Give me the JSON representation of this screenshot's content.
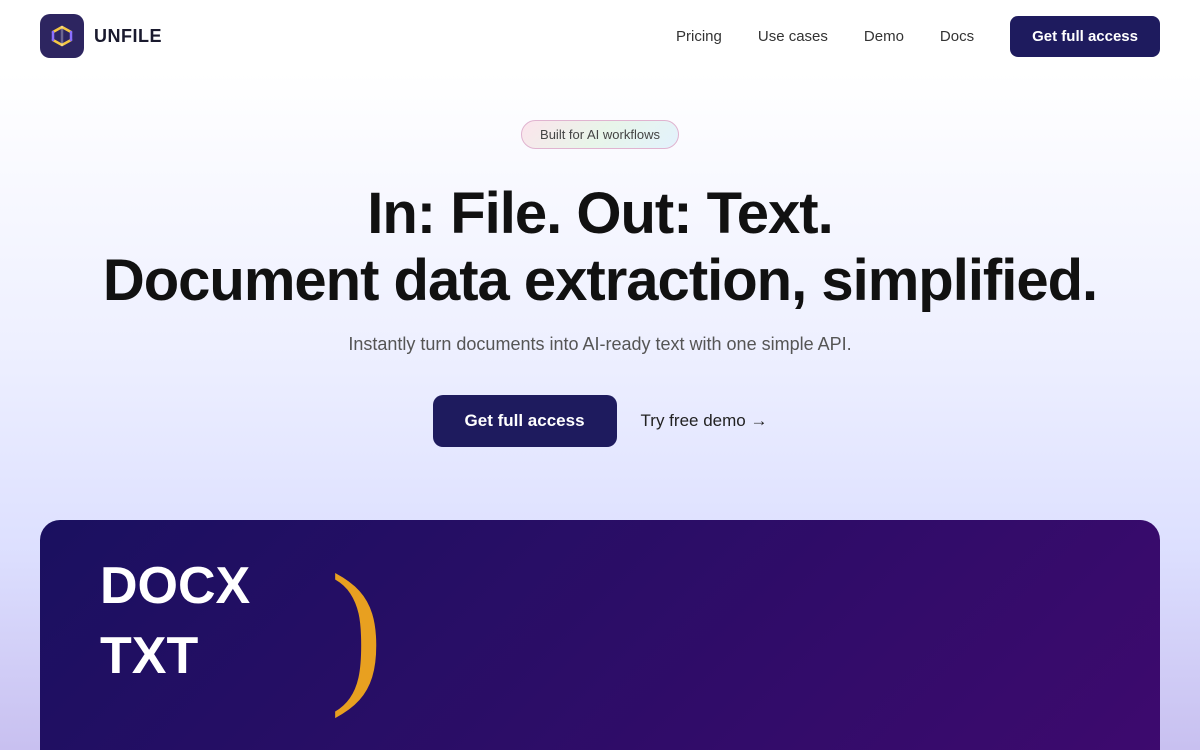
{
  "header": {
    "logo_text": "UNFILE",
    "nav": {
      "items": [
        {
          "label": "Pricing",
          "id": "pricing"
        },
        {
          "label": "Use cases",
          "id": "use-cases"
        },
        {
          "label": "Demo",
          "id": "demo"
        },
        {
          "label": "Docs",
          "id": "docs"
        }
      ],
      "cta_label": "Get full access"
    }
  },
  "hero": {
    "badge_text": "Built for AI workflows",
    "headline_line1": "In: File. Out: Text.",
    "headline_line2": "Document data extraction, simplified.",
    "subheadline": "Instantly turn documents into AI-ready text with one simple API.",
    "cta_primary": "Get full access",
    "cta_secondary": "Try free demo →"
  },
  "demo_card": {
    "label1": "DOCX",
    "label2": "TXT",
    "bracket": ")"
  }
}
